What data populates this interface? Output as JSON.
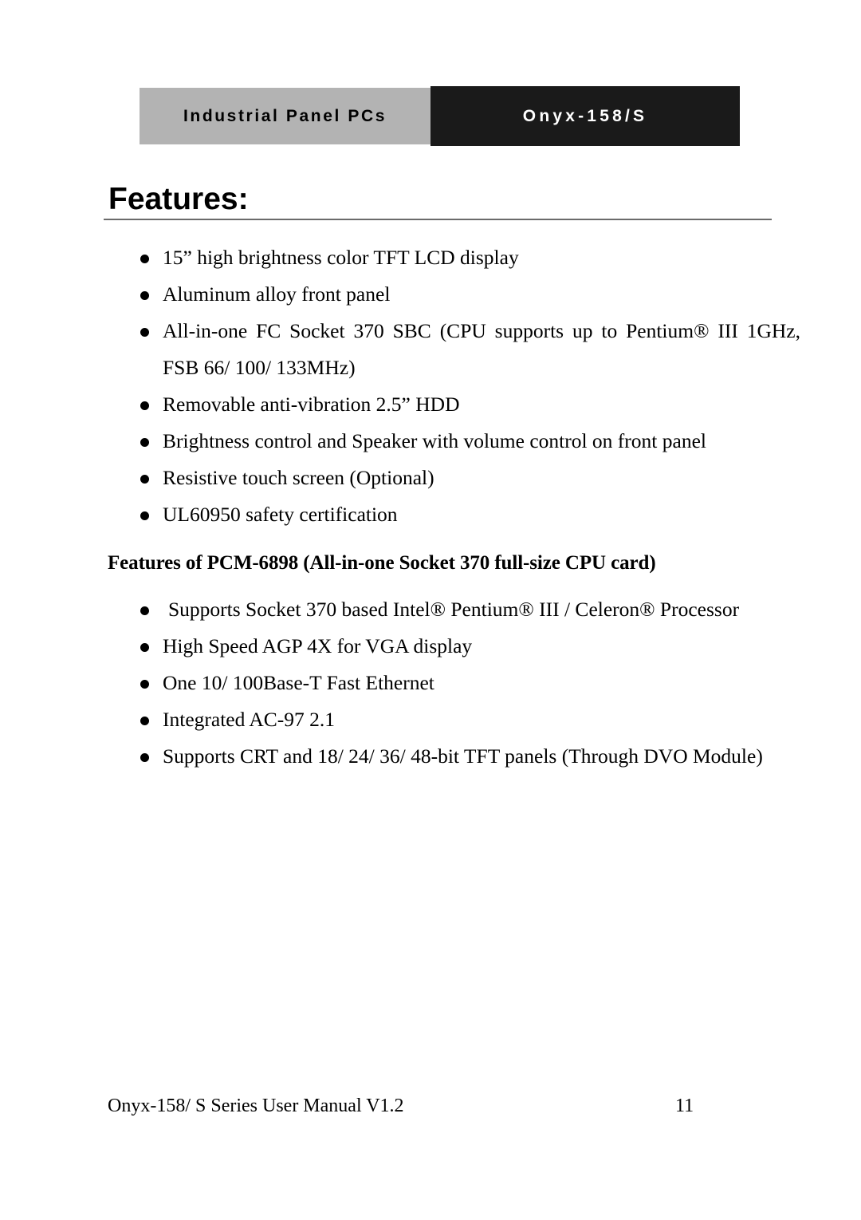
{
  "header": {
    "left_label": "Industrial Panel PCs",
    "right_label": "Onyx-158/S",
    "left_bg": "#b3b3b3",
    "right_bg": "#1a1a1a"
  },
  "title": "Features:",
  "features_list": [
    "15” high brightness color TFT LCD display",
    "Aluminum alloy front panel",
    "All-in-one FC Socket 370 SBC (CPU supports up to Pentium® III 1GHz, FSB 66/ 100/ 133MHz)",
    "Removable anti-vibration 2.5” HDD",
    "Brightness control and Speaker with volume control on front panel",
    "Resistive touch screen (Optional)",
    "UL60950 safety certification"
  ],
  "subheading": "Features of PCM-6898 (All-in-one Socket 370 full-size CPU card)",
  "pcm_list": [
    "Supports Socket 370 based Intel® Pentium® III /  Celeron® Processor",
    "High Speed AGP 4X for VGA display",
    "One 10/ 100Base-T Fast Ethernet",
    "Integrated AC-97 2.1",
    "Supports CRT and 18/ 24/ 36/ 48-bit TFT panels (Through DVO Module)"
  ],
  "footer": {
    "manual_text": "Onyx-158/ S Series User Manual V1.2",
    "page_number": "11"
  }
}
